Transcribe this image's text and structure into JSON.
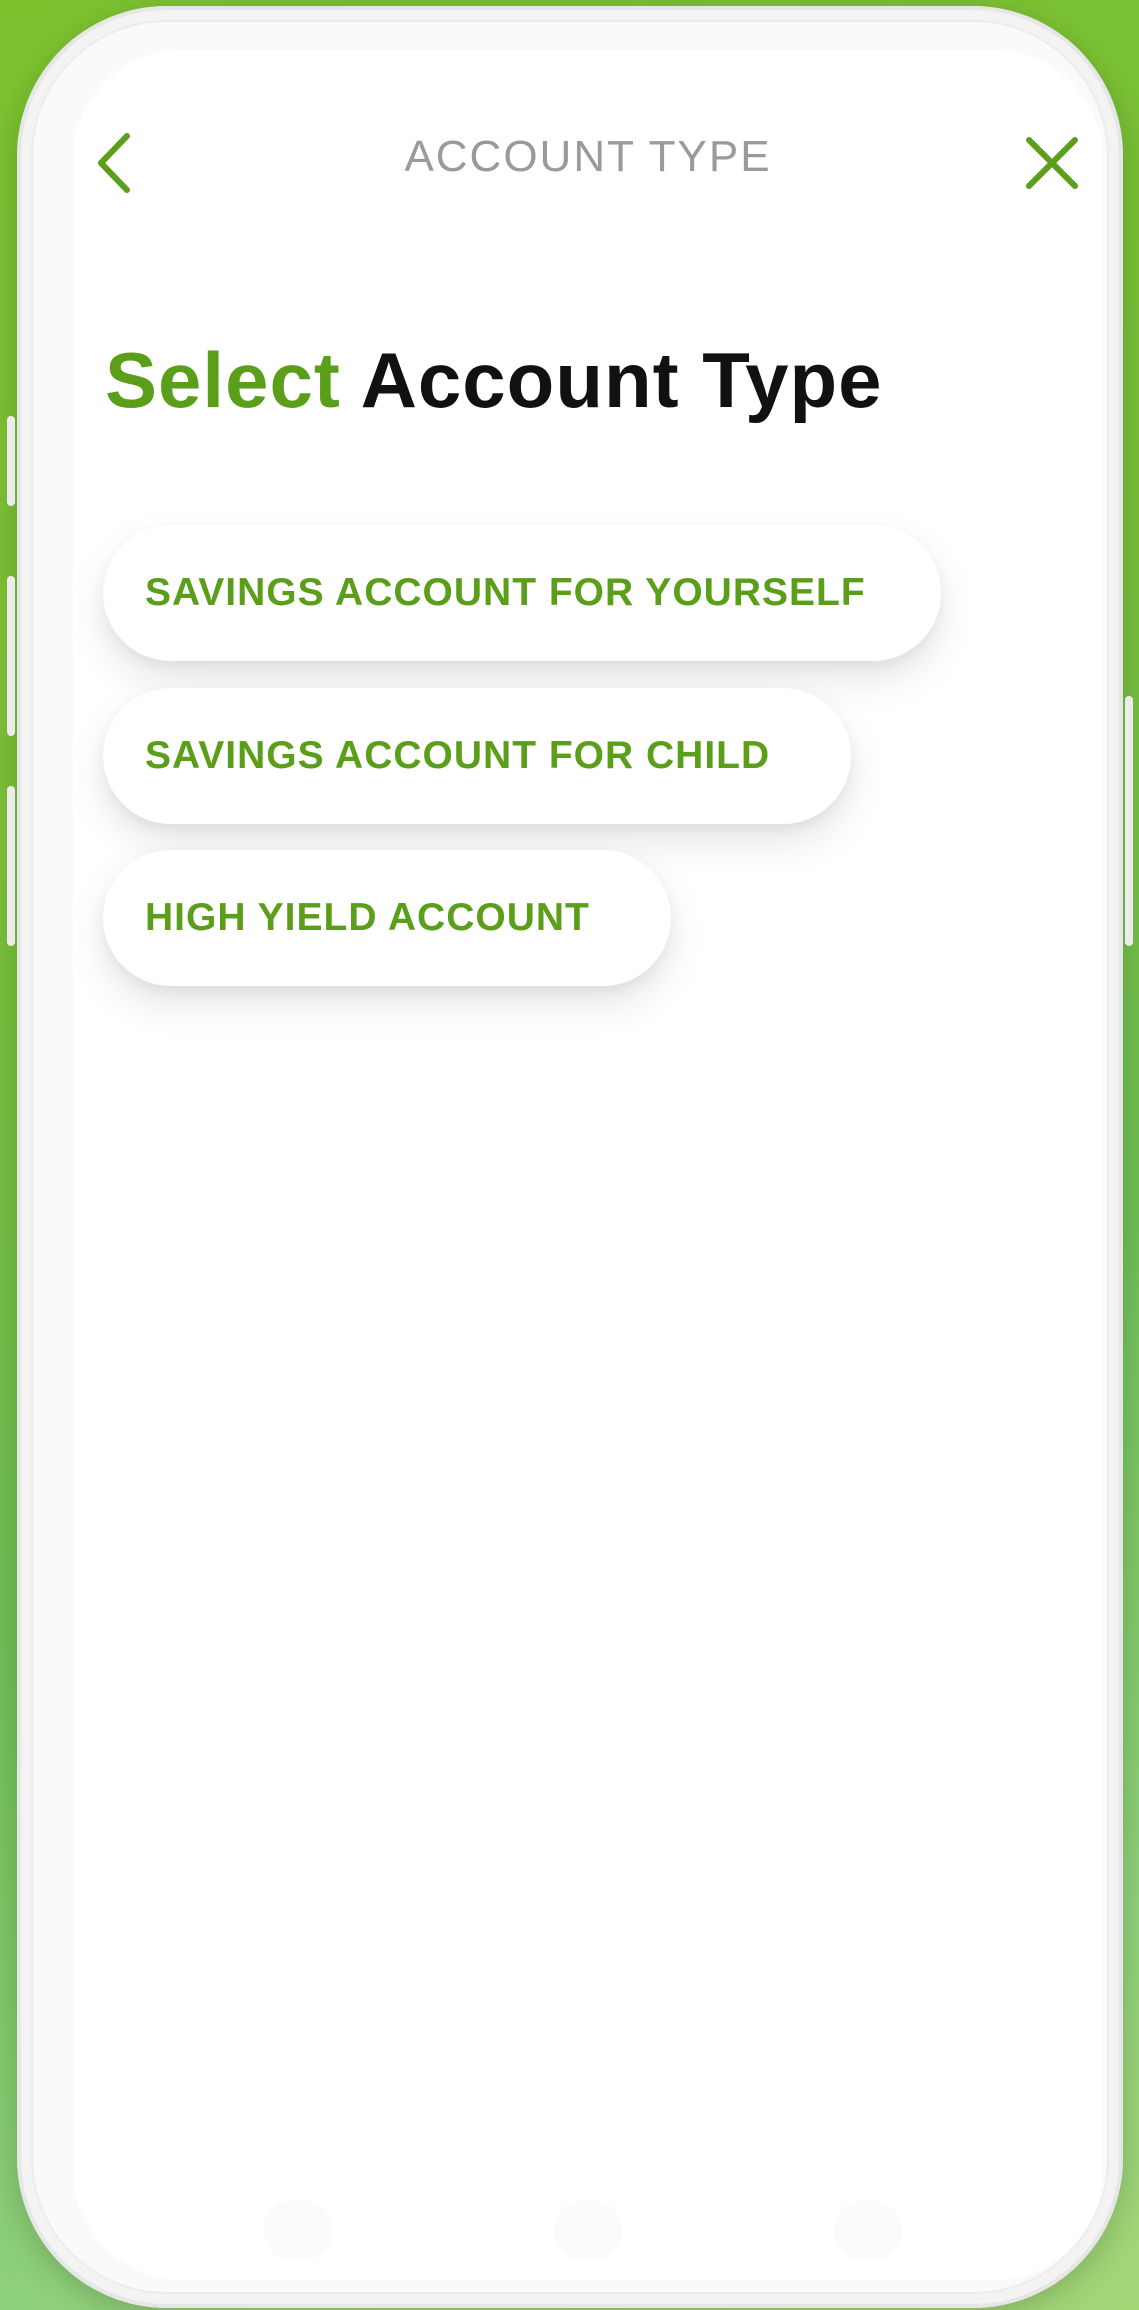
{
  "header": {
    "title": "ACCOUNT TYPE",
    "back_icon": "chevron-left-icon",
    "close_icon": "close-icon"
  },
  "heading": {
    "accent": "Select",
    "rest": "Account Type"
  },
  "options": [
    {
      "label": "SAVINGS ACCOUNT FOR YOURSELF"
    },
    {
      "label": "SAVINGS ACCOUNT FOR CHILD"
    },
    {
      "label": "HIGH YIELD ACCOUNT"
    }
  ],
  "colors": {
    "accent": "#5a9e1a",
    "title_gray": "#9a9a9a",
    "background_green": "#7cc22f"
  }
}
